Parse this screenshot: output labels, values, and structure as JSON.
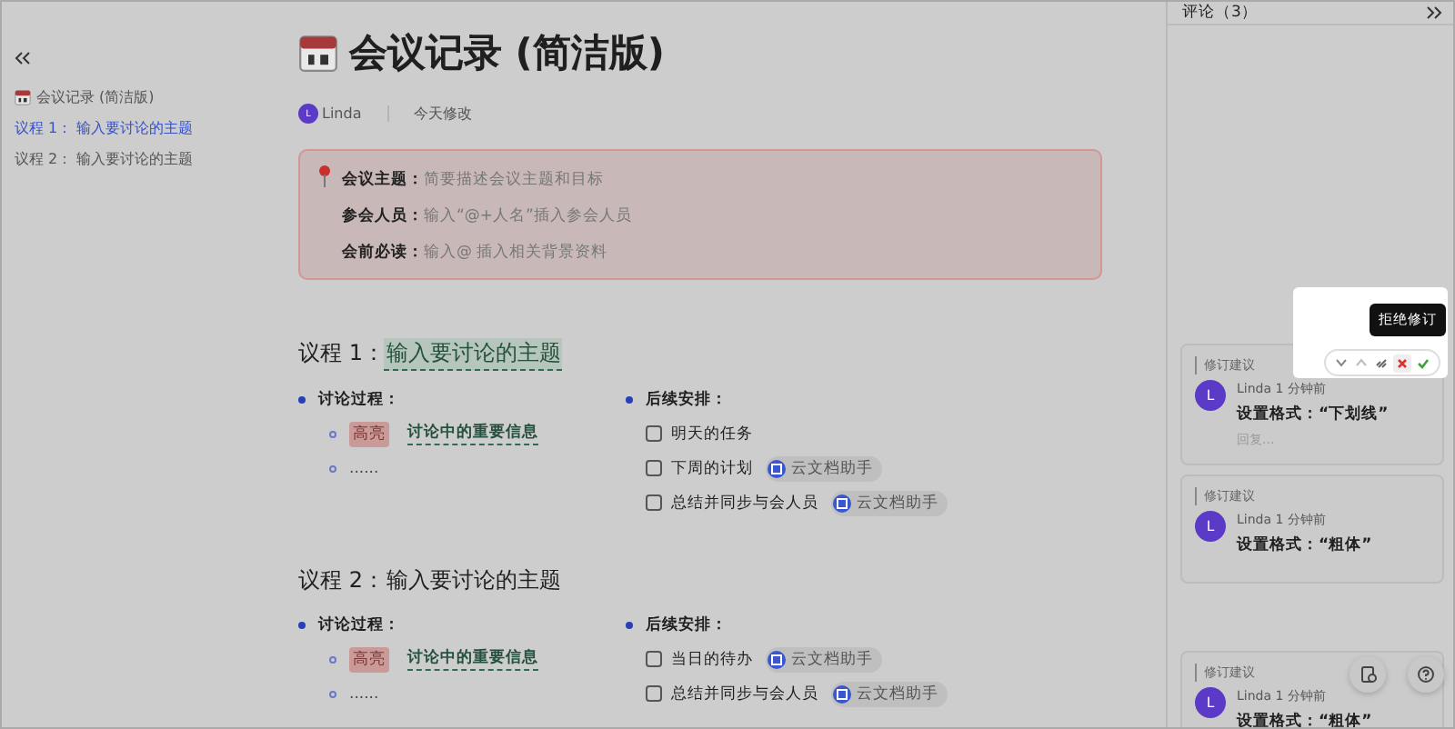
{
  "sidebar": {
    "items": [
      {
        "label": "会议记录 (简洁版)",
        "kind": "doc",
        "selected": false
      },
      {
        "label": "议程 1： 输入要讨论的主题",
        "kind": "heading",
        "selected": true
      },
      {
        "label": "议程 2： 输入要讨论的主题",
        "kind": "heading",
        "selected": false
      }
    ]
  },
  "doc": {
    "title": "会议记录 (简洁版)",
    "author": {
      "initial": "L",
      "name": "Linda"
    },
    "modified": "今天修改",
    "callout": [
      {
        "label": "会议主题：",
        "placeholder": "简要描述会议主题和目标"
      },
      {
        "label": "参会人员：",
        "placeholder": "输入“@+人名”插入参会人员"
      },
      {
        "label": "会前必读：",
        "placeholder": "输入@ 插入相关背景资料"
      }
    ],
    "agendas": [
      {
        "heading": "议程 1：",
        "topic": "输入要讨论的主题",
        "revised": true,
        "discussion": {
          "label": "讨论过程：",
          "items": [
            {
              "tag": "高亮",
              "text": "讨论中的重要信息",
              "revised": true
            },
            {
              "text": "......",
              "revised": false
            }
          ]
        },
        "followup": {
          "label": "后续安排：",
          "tasks": [
            {
              "text": "明天的任务",
              "checked": false
            },
            {
              "text": "下周的计划",
              "checked": false,
              "mention": "云文档助手"
            },
            {
              "text": "总结并同步与会人员",
              "checked": false,
              "mention": "云文档助手"
            }
          ]
        }
      },
      {
        "heading": "议程 2：",
        "topic": "输入要讨论的主题",
        "revised": false,
        "discussion": {
          "label": "讨论过程：",
          "items": [
            {
              "tag": "高亮",
              "text": "讨论中的重要信息",
              "revised": true
            },
            {
              "text": "......",
              "revised": false
            }
          ]
        },
        "followup": {
          "label": "后续安排：",
          "tasks": [
            {
              "text": "当日的待办",
              "checked": false,
              "mention": "云文档助手"
            },
            {
              "text": "总结并同步与会人员",
              "checked": false,
              "mention": "云文档助手"
            }
          ]
        }
      }
    ]
  },
  "comments": {
    "title": "评论（3）",
    "tooltip": "拒绝修订",
    "cards": [
      {
        "kind_label": "修订建议",
        "initial": "L",
        "author": "Linda",
        "time": "1 分钟前",
        "body": "设置格式：“下划线”",
        "reply": "回复..."
      },
      {
        "kind_label": "修订建议",
        "initial": "L",
        "author": "Linda",
        "time": "1 分钟前",
        "body": "设置格式：“粗体”"
      },
      {
        "kind_label": "修订建议",
        "initial": "L",
        "author": "Linda",
        "time": "1 分钟前",
        "body": "设置格式：“粗体”"
      }
    ]
  }
}
